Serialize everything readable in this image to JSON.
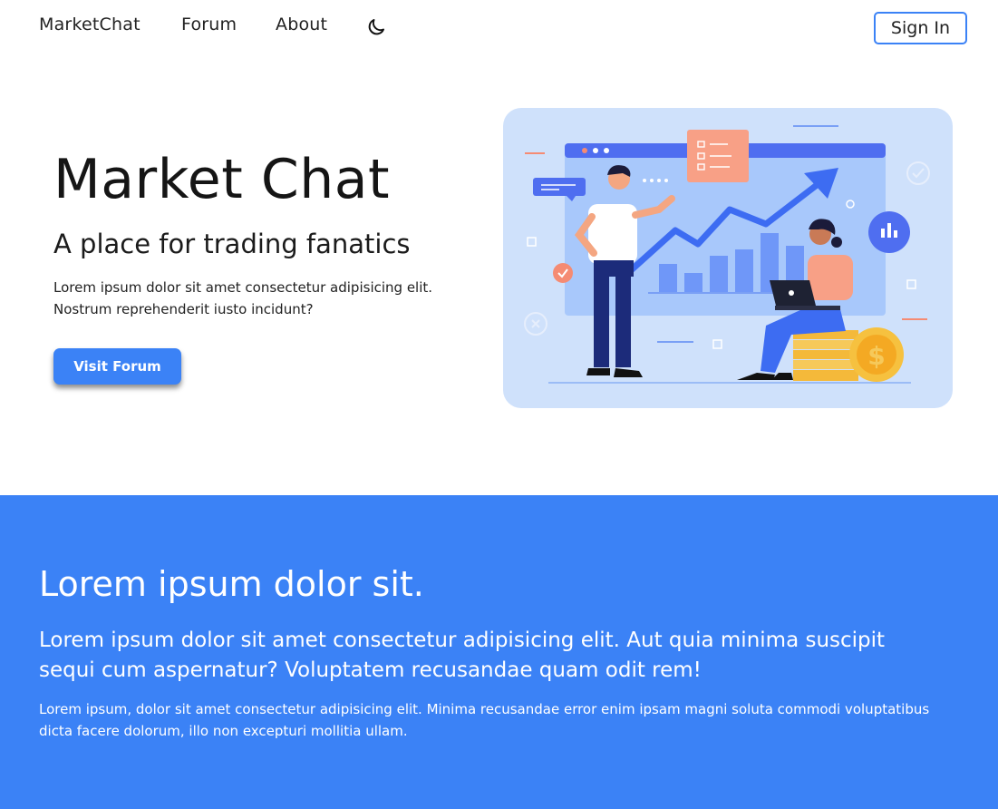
{
  "nav": {
    "brand": "MarketChat",
    "links": [
      "Forum",
      "About"
    ],
    "theme_icon": "moon-icon",
    "sign_in": "Sign In"
  },
  "hero": {
    "title": "Market Chat",
    "subtitle": "A place for trading fanatics",
    "text": "Lorem ipsum dolor sit amet consectetur adipisicing elit. Nostrum reprehenderit iusto incidunt?",
    "button": "Visit Forum",
    "illustration": "trading-illustration"
  },
  "section": {
    "heading": "Lorem ipsum dolor sit.",
    "lead": "Lorem ipsum dolor sit amet consectetur adipisicing elit. Aut quia minima suscipit sequi cum aspernatur? Voluptatem recusandae quam odit rem!",
    "body": "Lorem ipsum, dolor sit amet consectetur adipisicing elit. Minima recusandae error enim ipsam magni soluta commodi voluptatibus dicta facere dolorum, illo non excepturi mollitia ullam."
  },
  "colors": {
    "accent": "#3b82f6",
    "illustration_bg": "#cfe1fb"
  }
}
